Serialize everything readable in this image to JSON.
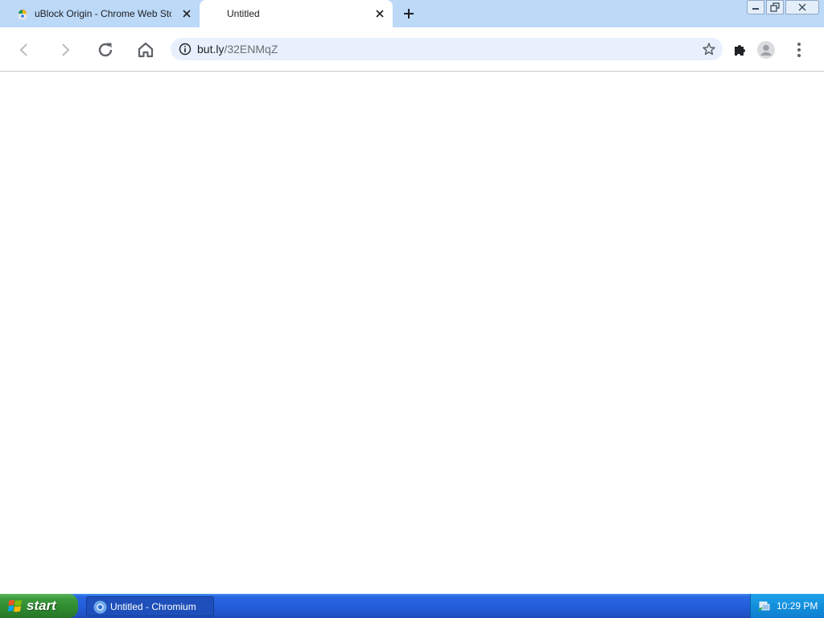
{
  "tabs": [
    {
      "title": "uBlock Origin - Chrome Web Store",
      "active": false,
      "favicon": "chrome-web-store-icon"
    },
    {
      "title": "Untitled",
      "active": true,
      "favicon": ""
    }
  ],
  "toolbar": {
    "back_icon": "back-arrow-icon",
    "forward_icon": "forward-arrow-icon",
    "reload_icon": "reload-icon",
    "home_icon": "home-icon",
    "extensions_icon": "puzzle-piece-icon",
    "profile_icon": "avatar-icon",
    "menu_icon": "kebab-menu-icon"
  },
  "omnibox": {
    "url_host": "but.ly",
    "url_path": "/32ENMqZ"
  },
  "taskbar": {
    "start_label": "start",
    "task_label": "Untitled - Chromium",
    "clock": "10:29 PM"
  },
  "colors": {
    "tabstrip_bg": "#bcd9f8",
    "omnibox_bg": "#e8f0fd",
    "taskbar_blue": "#245edb",
    "start_green": "#3c9a3c",
    "tray_blue": "#138fdc"
  }
}
